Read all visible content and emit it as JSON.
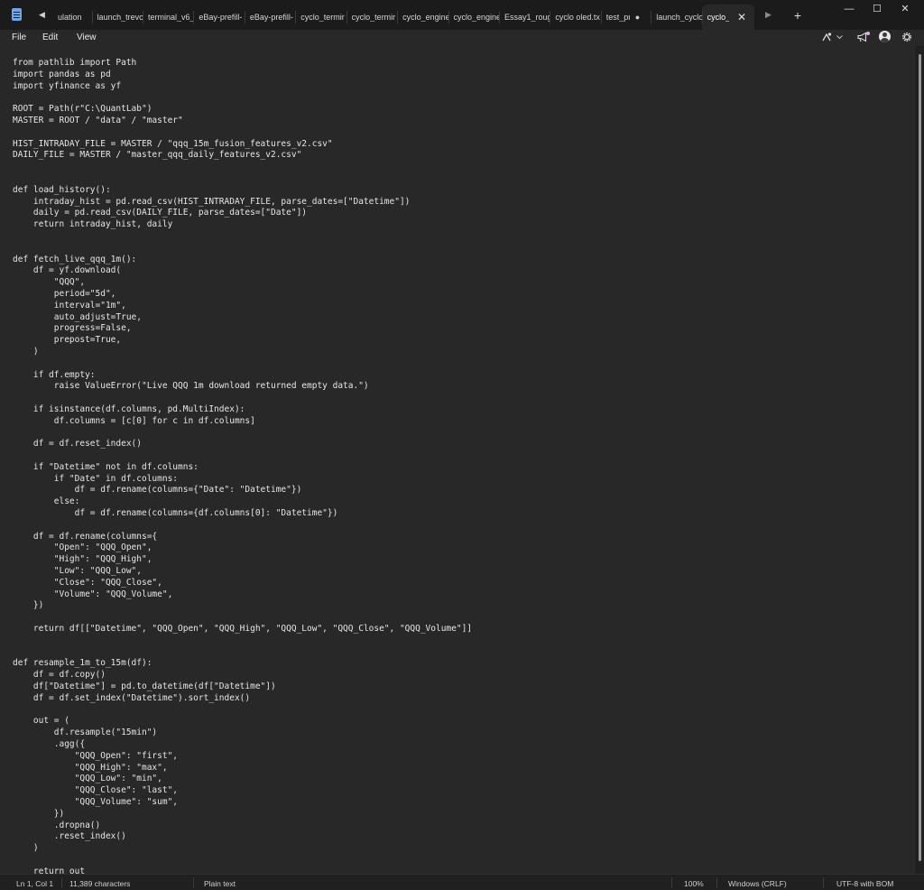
{
  "tabs": [
    {
      "label": "ulation"
    },
    {
      "label": "launch_trevc"
    },
    {
      "label": "terminal_v6_"
    },
    {
      "label": "eBay-prefill-"
    },
    {
      "label": "eBay-prefill-"
    },
    {
      "label": "cyclo_termir"
    },
    {
      "label": "cyclo_termir"
    },
    {
      "label": "cyclo_engine"
    },
    {
      "label": "cyclo_engine"
    },
    {
      "label": "Essay1_rougl"
    },
    {
      "label": "cyclo oled.tx"
    },
    {
      "label": "test_pr",
      "dot": "●"
    },
    {
      "label": "launch_cyclo"
    },
    {
      "label": "cyclo_",
      "close": "✕"
    }
  ],
  "tab_nav": {
    "left": "◀",
    "right": "▶",
    "new_tab": "+"
  },
  "window_controls": {
    "minimize": "—",
    "maximize": "☐",
    "close": "✕"
  },
  "menu": {
    "file": "File",
    "edit": "Edit",
    "view": "View"
  },
  "toolbar_icons": {
    "copilot": "copilot-icon",
    "chevron": "chevron-down-icon",
    "announce": "megaphone-icon",
    "account": "account-avatar-icon",
    "settings": "gear-icon"
  },
  "editor": {
    "lines": [
      "from pathlib import Path",
      "import pandas as pd",
      "import yfinance as yf",
      "",
      "ROOT = Path(r\"C:\\QuantLab\")",
      "MASTER = ROOT / \"data\" / \"master\"",
      "",
      "HIST_INTRADAY_FILE = MASTER / \"qqq_15m_fusion_features_v2.csv\"",
      "DAILY_FILE = MASTER / \"master_qqq_daily_features_v2.csv\"",
      "",
      "",
      "def load_history():",
      "    intraday_hist = pd.read_csv(HIST_INTRADAY_FILE, parse_dates=[\"Datetime\"])",
      "    daily = pd.read_csv(DAILY_FILE, parse_dates=[\"Date\"])",
      "    return intraday_hist, daily",
      "",
      "",
      "def fetch_live_qqq_1m():",
      "    df = yf.download(",
      "        \"QQQ\",",
      "        period=\"5d\",",
      "        interval=\"1m\",",
      "        auto_adjust=True,",
      "        progress=False,",
      "        prepost=True,",
      "    )",
      "",
      "    if df.empty:",
      "        raise ValueError(\"Live QQQ 1m download returned empty data.\")",
      "",
      "    if isinstance(df.columns, pd.MultiIndex):",
      "        df.columns = [c[0] for c in df.columns]",
      "",
      "    df = df.reset_index()",
      "",
      "    if \"Datetime\" not in df.columns:",
      "        if \"Date\" in df.columns:",
      "            df = df.rename(columns={\"Date\": \"Datetime\"})",
      "        else:",
      "            df = df.rename(columns={df.columns[0]: \"Datetime\"})",
      "",
      "    df = df.rename(columns={",
      "        \"Open\": \"QQQ_Open\",",
      "        \"High\": \"QQQ_High\",",
      "        \"Low\": \"QQQ_Low\",",
      "        \"Close\": \"QQQ_Close\",",
      "        \"Volume\": \"QQQ_Volume\",",
      "    })",
      "",
      "    return df[[\"Datetime\", \"QQQ_Open\", \"QQQ_High\", \"QQQ_Low\", \"QQQ_Close\", \"QQQ_Volume\"]]",
      "",
      "",
      "def resample_1m_to_15m(df):",
      "    df = df.copy()",
      "    df[\"Datetime\"] = pd.to_datetime(df[\"Datetime\"])",
      "    df = df.set_index(\"Datetime\").sort_index()",
      "",
      "    out = (",
      "        df.resample(\"15min\")",
      "        .agg({",
      "            \"QQQ_Open\": \"first\",",
      "            \"QQQ_High\": \"max\",",
      "            \"QQQ_Low\": \"min\",",
      "            \"QQQ_Close\": \"last\",",
      "            \"QQQ_Volume\": \"sum\",",
      "        })",
      "        .dropna()",
      "        .reset_index()",
      "    )",
      "",
      "    return out"
    ]
  },
  "status": {
    "position": "Ln 1, Col 1",
    "characters": "11,389 characters",
    "language": "Plain text",
    "zoom": "100%",
    "line_ending": "Windows (CRLF)",
    "encoding": "UTF-8 with BOM"
  }
}
